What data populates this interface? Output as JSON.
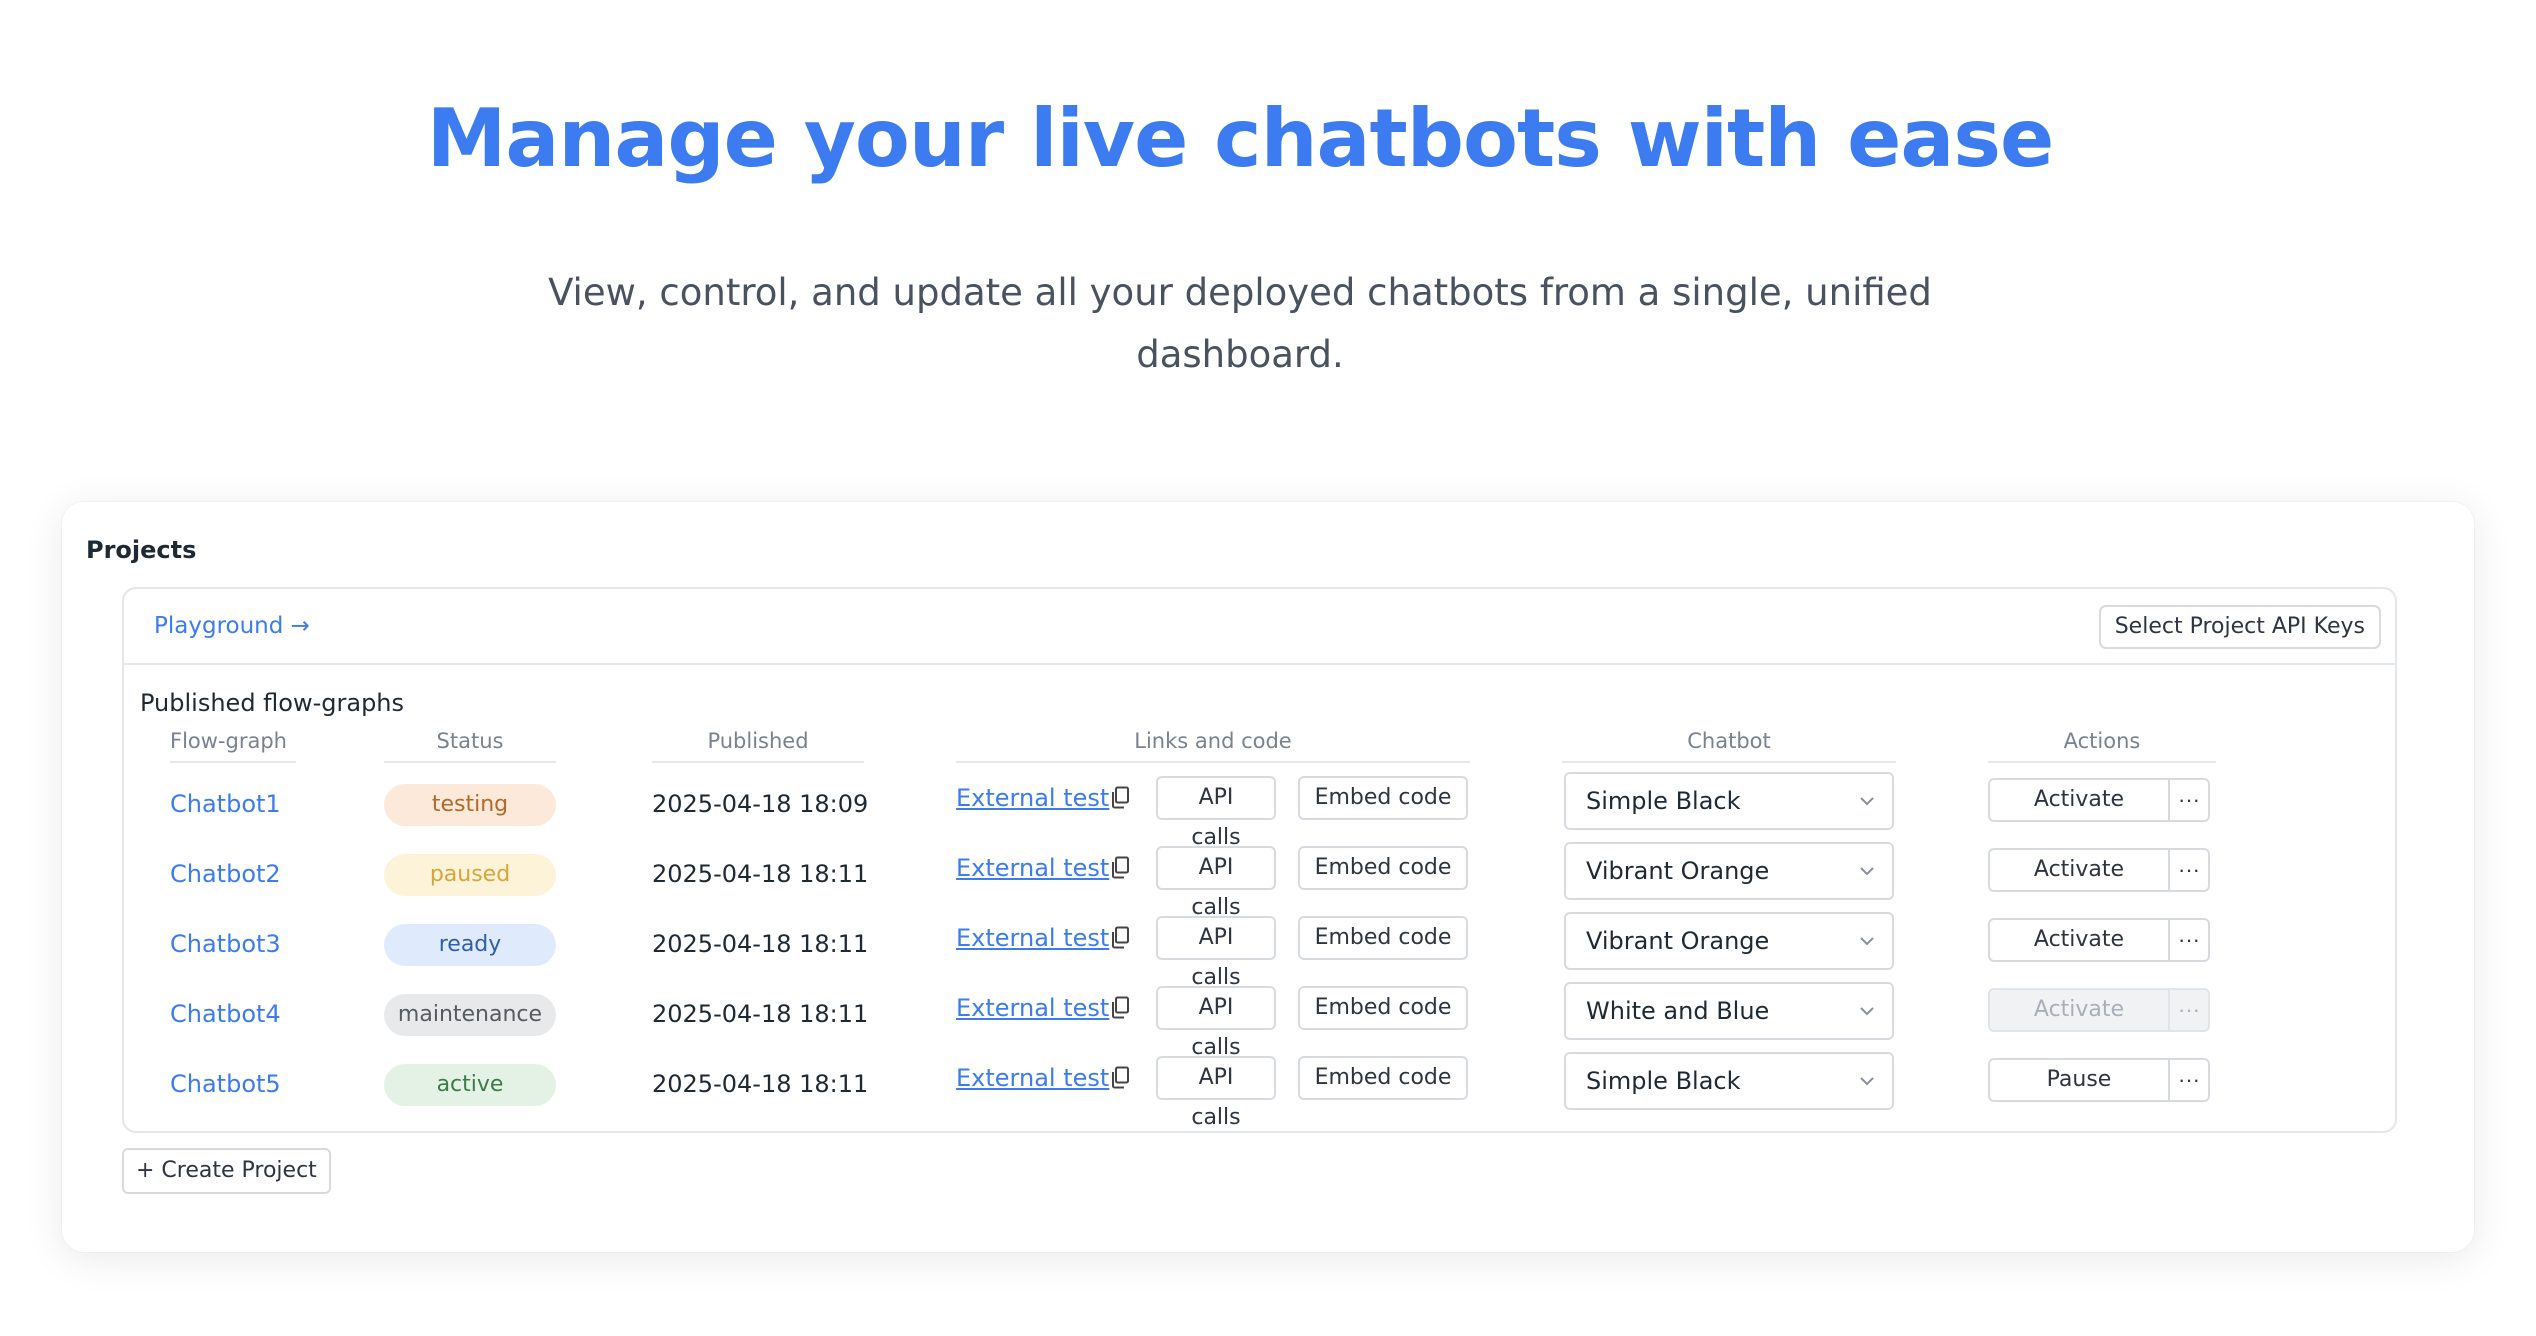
{
  "hero": {
    "title": "Manage your live chatbots with ease",
    "subtitle": "View, control, and update all your deployed chatbots from a single, unified dashboard."
  },
  "projects": {
    "label": "Projects",
    "playground_link": "Playground →",
    "api_keys_button": "Select Project API Keys",
    "section_title": "Published flow-graphs",
    "columns": [
      "Flow-graph",
      "Status",
      "Published",
      "Links and code",
      "Chatbot",
      "Actions"
    ],
    "rows": [
      {
        "name": "Chatbot1",
        "status": "testing",
        "published": "2025-04-18 18:09",
        "link": "External test",
        "api": "API calls",
        "embed": "Embed code",
        "chatbot": "Simple Black",
        "action": "Activate",
        "more": "···",
        "action_disabled": false
      },
      {
        "name": "Chatbot2",
        "status": "paused",
        "published": "2025-04-18 18:11",
        "link": "External test",
        "api": "API calls",
        "embed": "Embed code",
        "chatbot": "Vibrant Orange",
        "action": "Activate",
        "more": "···",
        "action_disabled": false
      },
      {
        "name": "Chatbot3",
        "status": "ready",
        "published": "2025-04-18 18:11",
        "link": "External test",
        "api": "API calls",
        "embed": "Embed code",
        "chatbot": "Vibrant Orange",
        "action": "Activate",
        "more": "···",
        "action_disabled": false
      },
      {
        "name": "Chatbot4",
        "status": "maintenance",
        "published": "2025-04-18 18:11",
        "link": "External test",
        "api": "API calls",
        "embed": "Embed code",
        "chatbot": "White and Blue",
        "action": "Activate",
        "more": "···",
        "action_disabled": true
      },
      {
        "name": "Chatbot5",
        "status": "active",
        "published": "2025-04-18 18:11",
        "link": "External test",
        "api": "API calls",
        "embed": "Embed code",
        "chatbot": "Simple Black",
        "action": "Pause",
        "more": "···",
        "action_disabled": false
      }
    ],
    "create_button": "+ Create Project"
  },
  "status_colors": {
    "testing": {
      "bg": "#fde9d9",
      "fg": "#b4692a"
    },
    "paused": {
      "bg": "#fdf3d8",
      "fg": "#d9a43c"
    },
    "ready": {
      "bg": "#dfeafc",
      "fg": "#2f5fa8"
    },
    "maintenance": {
      "bg": "#e8e9eb",
      "fg": "#555b63"
    },
    "active": {
      "bg": "#e4f2e6",
      "fg": "#3d7a48"
    }
  },
  "colors": {
    "accent": "#3d7cf0"
  },
  "icons": {
    "copy": "copy-icon",
    "chevron": "chevron-down-icon",
    "more": "more-icon"
  }
}
